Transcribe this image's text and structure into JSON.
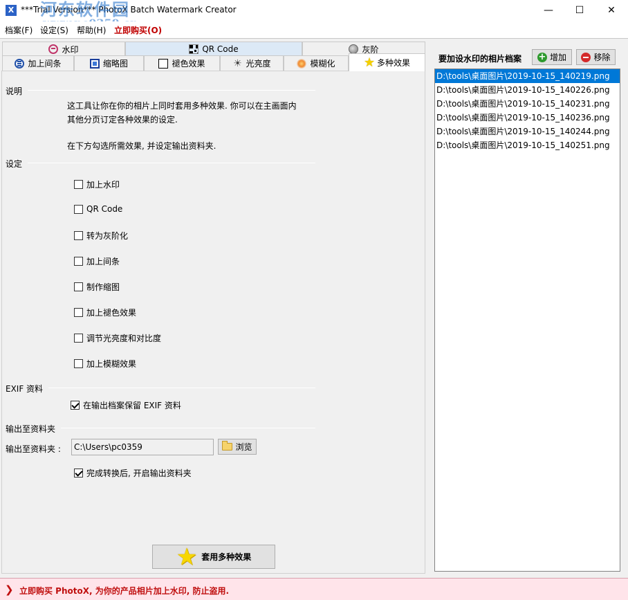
{
  "window": {
    "app_icon": "X",
    "title": "***Trial Version*** PhotoX Batch Watermark Creator",
    "watermark_line1": "河东软件园",
    "watermark_line2": "www.pc0359.cn",
    "minimize": "—",
    "maximize": "☐",
    "close": "✕"
  },
  "menu": {
    "file": "档案(F)",
    "settings": "设定(S)",
    "help": "帮助(H)",
    "buy": "立即购买(O)",
    "buy_color": "#c00000"
  },
  "tabs": {
    "row1": [
      {
        "label": "水印",
        "icon": "watermark-icon"
      },
      {
        "label": "QR Code",
        "icon": "qr-code-icon"
      },
      {
        "label": "灰阶",
        "icon": "grayscale-icon"
      }
    ],
    "row2": [
      {
        "label": "加上间条",
        "icon": "border-icon"
      },
      {
        "label": "缩略图",
        "icon": "thumbnail-icon"
      },
      {
        "label": "褪色效果",
        "icon": "sepia-icon"
      },
      {
        "label": "光亮度",
        "icon": "brightness-icon"
      },
      {
        "label": "模糊化",
        "icon": "blur-icon"
      },
      {
        "label": "多种效果",
        "icon": "star-icon",
        "selected": true
      }
    ]
  },
  "description": {
    "title": "说明",
    "line1": "这工具让你在你的相片上同时套用多种效果. 你可以在主画面内",
    "line2": "其他分页订定各种效果的设定.",
    "line3": "在下方勾选所需效果, 并设定输出资料夹."
  },
  "settings": {
    "title": "设定",
    "options": [
      {
        "label": "加上水印",
        "checked": false
      },
      {
        "label": "QR Code",
        "checked": false
      },
      {
        "label": "转为灰阶化",
        "checked": false
      },
      {
        "label": "加上间条",
        "checked": false
      },
      {
        "label": "制作缩图",
        "checked": false
      },
      {
        "label": "加上褪色效果",
        "checked": false
      },
      {
        "label": "调节光亮度和对比度",
        "checked": false
      },
      {
        "label": "加上模糊效果",
        "checked": false
      }
    ]
  },
  "exif": {
    "title": "EXIF 资料",
    "keep_label": "在输出档案保留 EXIF 资料",
    "keep_checked": true
  },
  "output": {
    "title": "输出至资料夹",
    "label": "输出至资料夹 :",
    "path": "C:\\Users\\pc0359",
    "browse": "浏览",
    "open_after_label": "完成转换后, 开启输出资料夹",
    "open_after_checked": true
  },
  "apply_button": "套用多种效果",
  "files": {
    "label": "要加设水印的相片档案",
    "add": "增加",
    "remove": "移除",
    "items": [
      "D:\\tools\\桌面图片\\2019-10-15_140219.png",
      "D:\\tools\\桌面图片\\2019-10-15_140226.png",
      "D:\\tools\\桌面图片\\2019-10-15_140231.png",
      "D:\\tools\\桌面图片\\2019-10-15_140236.png",
      "D:\\tools\\桌面图片\\2019-10-15_140244.png",
      "D:\\tools\\桌面图片\\2019-10-15_140251.png"
    ],
    "selected_index": 0
  },
  "status": {
    "arrow": "❯",
    "text": "立即购买 PhotoX, 为你的产品相片加上水印, 防止盗用.",
    "color": "#c01010"
  }
}
